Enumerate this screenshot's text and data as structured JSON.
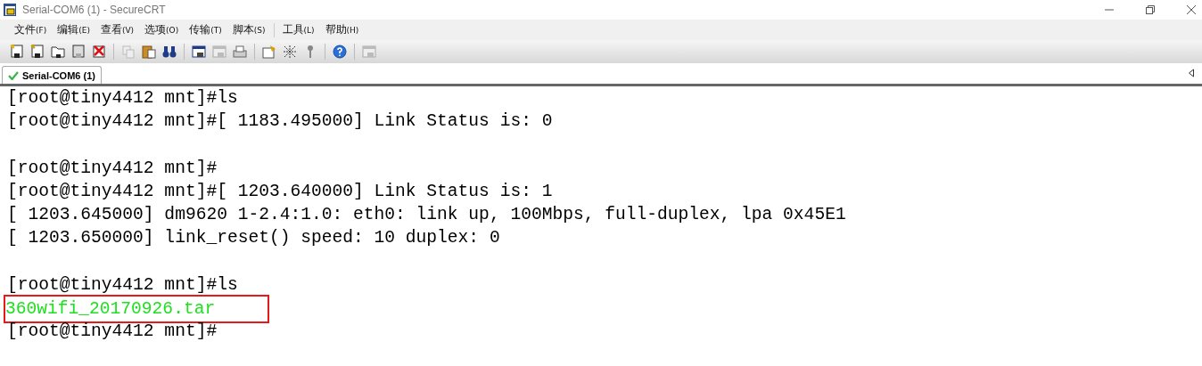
{
  "window": {
    "title": "Serial-COM6 (1) - SecureCRT"
  },
  "menu": [
    {
      "label": "文件",
      "key": "(F)"
    },
    {
      "label": "编辑",
      "key": "(E)"
    },
    {
      "label": "查看",
      "key": "(V)"
    },
    {
      "label": "选项",
      "key": "(O)"
    },
    {
      "label": "传输",
      "key": "(T)"
    },
    {
      "label": "脚本",
      "key": "(S)"
    },
    {
      "label": "工具",
      "key": "(L)"
    },
    {
      "label": "帮助",
      "key": "(H)"
    }
  ],
  "tabs": [
    {
      "label": "Serial-COM6 (1)",
      "selected": true
    }
  ],
  "terminal": {
    "lines": [
      {
        "kind": "normal",
        "text": "[root@tiny4412 mnt]#ls"
      },
      {
        "kind": "normal",
        "text": "[root@tiny4412 mnt]#[ 1183.495000] Link Status is: 0"
      },
      {
        "kind": "blank"
      },
      {
        "kind": "normal",
        "text": "[root@tiny4412 mnt]#"
      },
      {
        "kind": "normal",
        "text": "[root@tiny4412 mnt]#[ 1203.640000] Link Status is: 1"
      },
      {
        "kind": "normal",
        "text": "[ 1203.645000] dm9620 1-2.4:1.0: eth0: link up, 100Mbps, full-duplex, lpa 0x45E1"
      },
      {
        "kind": "normal",
        "text": "[ 1203.650000] link_reset() speed: 10 duplex: 0"
      },
      {
        "kind": "blank"
      },
      {
        "kind": "normal",
        "text": "[root@tiny4412 mnt]#ls"
      },
      {
        "kind": "file",
        "text": "360wifi_20170926.tar"
      },
      {
        "kind": "normal",
        "text": "[root@tiny4412 mnt]#"
      }
    ]
  }
}
